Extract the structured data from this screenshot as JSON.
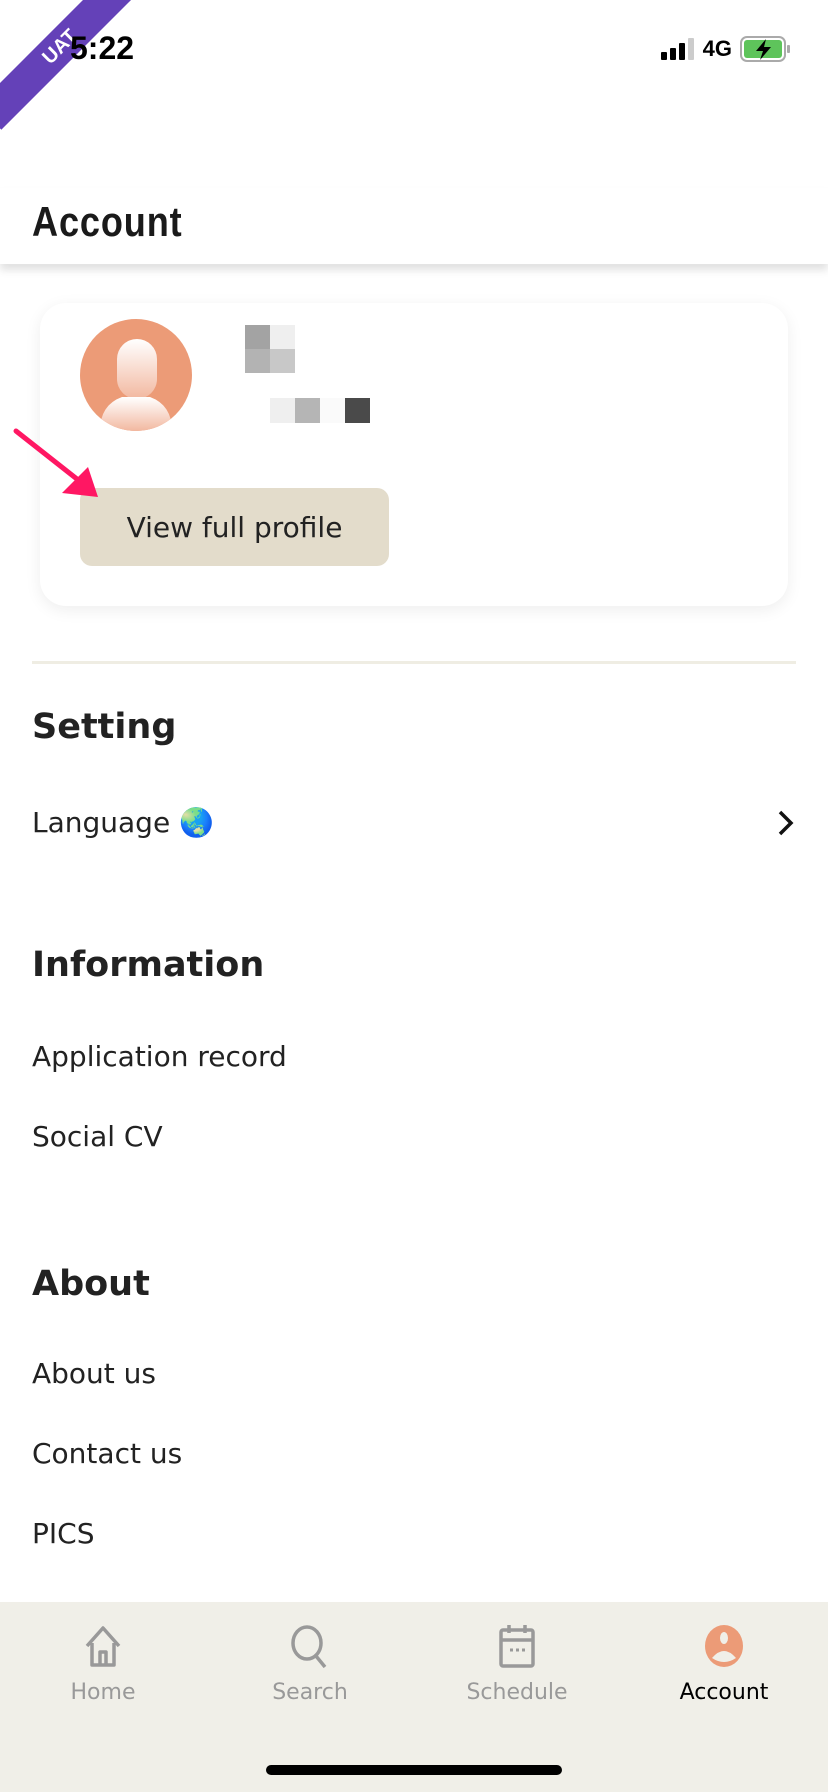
{
  "status_bar": {
    "time": "5:22",
    "network": "4G",
    "env_badge": "UAT"
  },
  "header": {
    "title": "Account"
  },
  "profile": {
    "view_profile_label": "View full profile"
  },
  "sections": {
    "setting": {
      "title": "Setting",
      "items": [
        {
          "label": "Language 🌏"
        }
      ]
    },
    "information": {
      "title": "Information",
      "items": [
        {
          "label": "Application record"
        },
        {
          "label": "Social CV"
        }
      ]
    },
    "about": {
      "title": "About",
      "items": [
        {
          "label": "About us"
        },
        {
          "label": "Contact us"
        },
        {
          "label": "PICS"
        }
      ]
    }
  },
  "bottom_nav": {
    "items": [
      {
        "label": "Home",
        "icon": "home-icon"
      },
      {
        "label": "Search",
        "icon": "search-icon"
      },
      {
        "label": "Schedule",
        "icon": "calendar-icon"
      },
      {
        "label": "Account",
        "icon": "account-icon",
        "active": true
      }
    ]
  },
  "colors": {
    "accent": "#ec9b77",
    "button_bg": "#e3dccb",
    "nav_bg": "#f0efe8",
    "annotation_arrow": "#ff1763",
    "uat_badge": "#6441b8"
  }
}
